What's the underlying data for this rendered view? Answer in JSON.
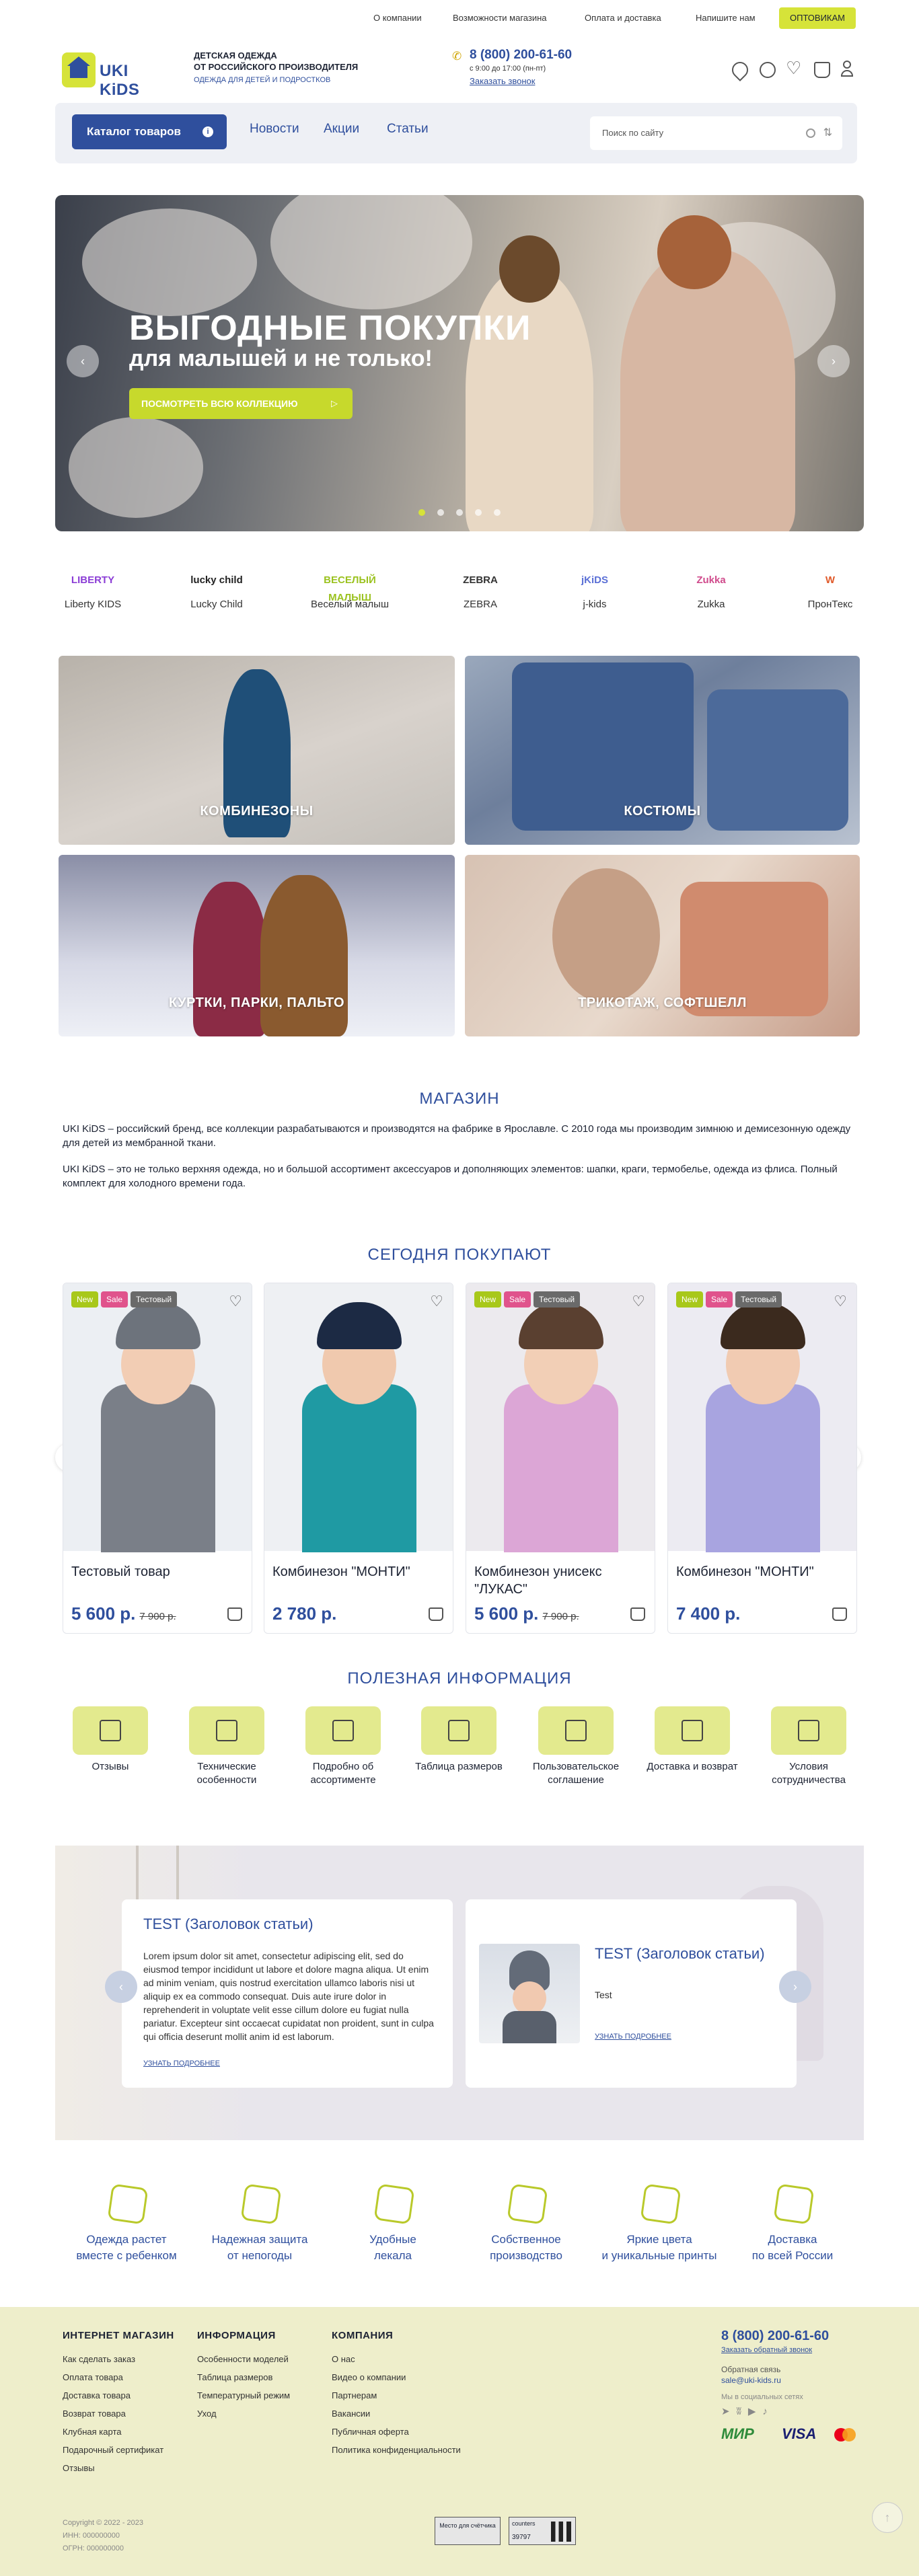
{
  "top_nav": {
    "items": [
      "О компании",
      "Возможности магазина",
      "Оплата и доставка",
      "Напишите нам"
    ],
    "wholesale_button": "ОПТОВИКАМ"
  },
  "header": {
    "logo_text": "UKI KiDS",
    "tagline_line1": "ДЕТСКАЯ ОДЕЖДА",
    "tagline_line2": "ОТ РОССИЙСКОГО ПРОИЗВОДИТЕЛЯ",
    "tagline_sub": "ОДЕЖДА ДЛЯ ДЕТЕЙ И ПОДРОСТКОВ",
    "phone": "8 (800) 200-61-60",
    "work_hours": "с 9:00 до 17:00 (пн-пт)",
    "callback": "Заказать звонок",
    "icons": [
      "map-pin-icon",
      "compare-icon",
      "heart-icon",
      "basket-icon",
      "user-icon"
    ]
  },
  "menu": {
    "catalog_button": "Каталог товаров",
    "catalog_badge": "i",
    "links": [
      "Новости",
      "Акции",
      "Статьи"
    ],
    "search_placeholder": "Поиск по сайту"
  },
  "hero": {
    "title": "ВЫГОДНЫЕ ПОКУПКИ",
    "subtitle": "для малышей и не только!",
    "button": "ПОСМОТРЕТЬ ВСЮ КОЛЛЕКЦИЮ",
    "prev": "‹",
    "next": "›",
    "slide_count": 5,
    "active_slide": 1
  },
  "brands": [
    {
      "logo": "LIBERTY",
      "name": "Liberty KIDS",
      "color": "#8b3dd6"
    },
    {
      "logo": "lucky child",
      "name": "Lucky Child",
      "color": "#222222"
    },
    {
      "logo": "ВЕСЕЛЫЙ МАЛЫШ",
      "name": "Веселый малыш",
      "color": "#9bc21f"
    },
    {
      "logo": "ZEBRA",
      "name": "ZEBRA",
      "color": "#333333"
    },
    {
      "logo": "jKiDS",
      "name": "j-kids",
      "color": "#5a6fd6"
    },
    {
      "logo": "Zukka",
      "name": "Zukka",
      "color": "#d04b8c"
    },
    {
      "logo": "W",
      "name": "ПронТекс",
      "color": "#e05a2a"
    }
  ],
  "categories": [
    "КОМБИНЕЗОНЫ",
    "КОСТЮМЫ",
    "КУРТКИ, ПАРКИ, ПАЛЬТО",
    "ТРИКОТАЖ, СОФТШЕЛЛ"
  ],
  "about": {
    "heading": "МАГАЗИН",
    "p1": "UKI KiDS – российский бренд, все коллекции разрабатываются и производятся на фабрике в Ярославле. С 2010 года мы производим зимнюю и демисезонную одежду для детей из мембранной ткани.",
    "p2": "UKI KiDS – это не только верхняя одежда, но и большой ассортимент аксессуаров и дополняющих элементов: шапки, краги, термобелье, одежда из флиса. Полный комплект для холодного времени года."
  },
  "products": {
    "heading": "СЕГОДНЯ ПОКУПАЮТ",
    "items": [
      {
        "title": "Тестовый товар",
        "price": "5 600 р.",
        "old_price": "7 900 р.",
        "badges": [
          "New",
          "Sale",
          "Тестовый"
        ]
      },
      {
        "title": "Комбинезон \"МОНТИ\"",
        "price": "2 780 р.",
        "old_price": "",
        "badges": []
      },
      {
        "title": "Комбинезон унисекс \"ЛУКАС\"",
        "price": "5 600 р.",
        "old_price": "7 900 р.",
        "badges": [
          "New",
          "Sale",
          "Тестовый"
        ]
      },
      {
        "title": "Комбинезон \"МОНТИ\"",
        "price": "7 400 р.",
        "old_price": "",
        "badges": [
          "New",
          "Sale",
          "Тестовый"
        ]
      }
    ]
  },
  "info": {
    "heading": "ПОЛЕЗНАЯ ИНФОРМАЦИЯ",
    "items": [
      "Отзывы",
      "Технические особенности",
      "Подробно об ассортименте",
      "Таблица размеров",
      "Пользовательское соглашение",
      "Доставка и возврат",
      "Условия сотрудничества"
    ]
  },
  "articles": [
    {
      "title": "TEST (Заголовок статьи)",
      "body": "Lorem ipsum dolor sit amet, consectetur adipiscing elit, sed do eiusmod tempor incididunt ut labore et dolore magna aliqua. Ut enim ad minim veniam, quis nostrud exercitation ullamco laboris nisi ut aliquip ex ea commodo consequat. Duis aute irure dolor in reprehenderit in voluptate velit esse cillum dolore eu fugiat nulla pariatur. Excepteur sint occaecat cupidatat non proident, sunt in culpa qui officia deserunt mollit anim id est laborum.",
      "more": "УЗНАТЬ ПОДРОБНЕЕ"
    },
    {
      "title": "TEST (Заголовок статьи)",
      "body": "Test",
      "more": "УЗНАТЬ ПОДРОБНЕЕ"
    }
  ],
  "features": [
    {
      "l1": "Одежда растет",
      "l2": "вместе с ребенком"
    },
    {
      "l1": "Надежная защита",
      "l2": "от непогоды"
    },
    {
      "l1": "Удобные",
      "l2": "лекала"
    },
    {
      "l1": "Собственное",
      "l2": "производство"
    },
    {
      "l1": "Яркие цвета",
      "l2": "и уникальные принты"
    },
    {
      "l1": "Доставка",
      "l2": "по всей России"
    }
  ],
  "footer": {
    "col1": {
      "heading": "ИНТЕРНЕТ МАГАЗИН",
      "links": [
        "Как сделать заказ",
        "Оплата товара",
        "Доставка товара",
        "Возврат товара",
        "Клубная карта",
        "Подарочный сертификат",
        "Отзывы"
      ]
    },
    "col2": {
      "heading": "ИНФОРМАЦИЯ",
      "links": [
        "Особенности моделей",
        "Таблица размеров",
        "Температурный режим",
        "Уход"
      ]
    },
    "col3": {
      "heading": "КОМПАНИЯ",
      "links": [
        "О нас",
        "Видео о компании",
        "Партнерам",
        "Вакансии",
        "Публичная оферта",
        "Политика конфиденциальности"
      ]
    },
    "phone": "8 (800) 200-61-60",
    "callback": "Заказать обратный звонок",
    "feedback_label": "Обратная связь",
    "email": "sale@uki-kids.ru",
    "social_label": "Мы в социальных сетях",
    "payments": [
      "МИР",
      "VISA",
      "MC"
    ],
    "copyright": "Copyright © 2022 - 2023",
    "inn": "ИНН: 000000000",
    "ogrn": "ОГРН: 000000000",
    "counter_label": "Место для счётчика",
    "counter2_top": "counters",
    "counter2_num": "39797"
  }
}
